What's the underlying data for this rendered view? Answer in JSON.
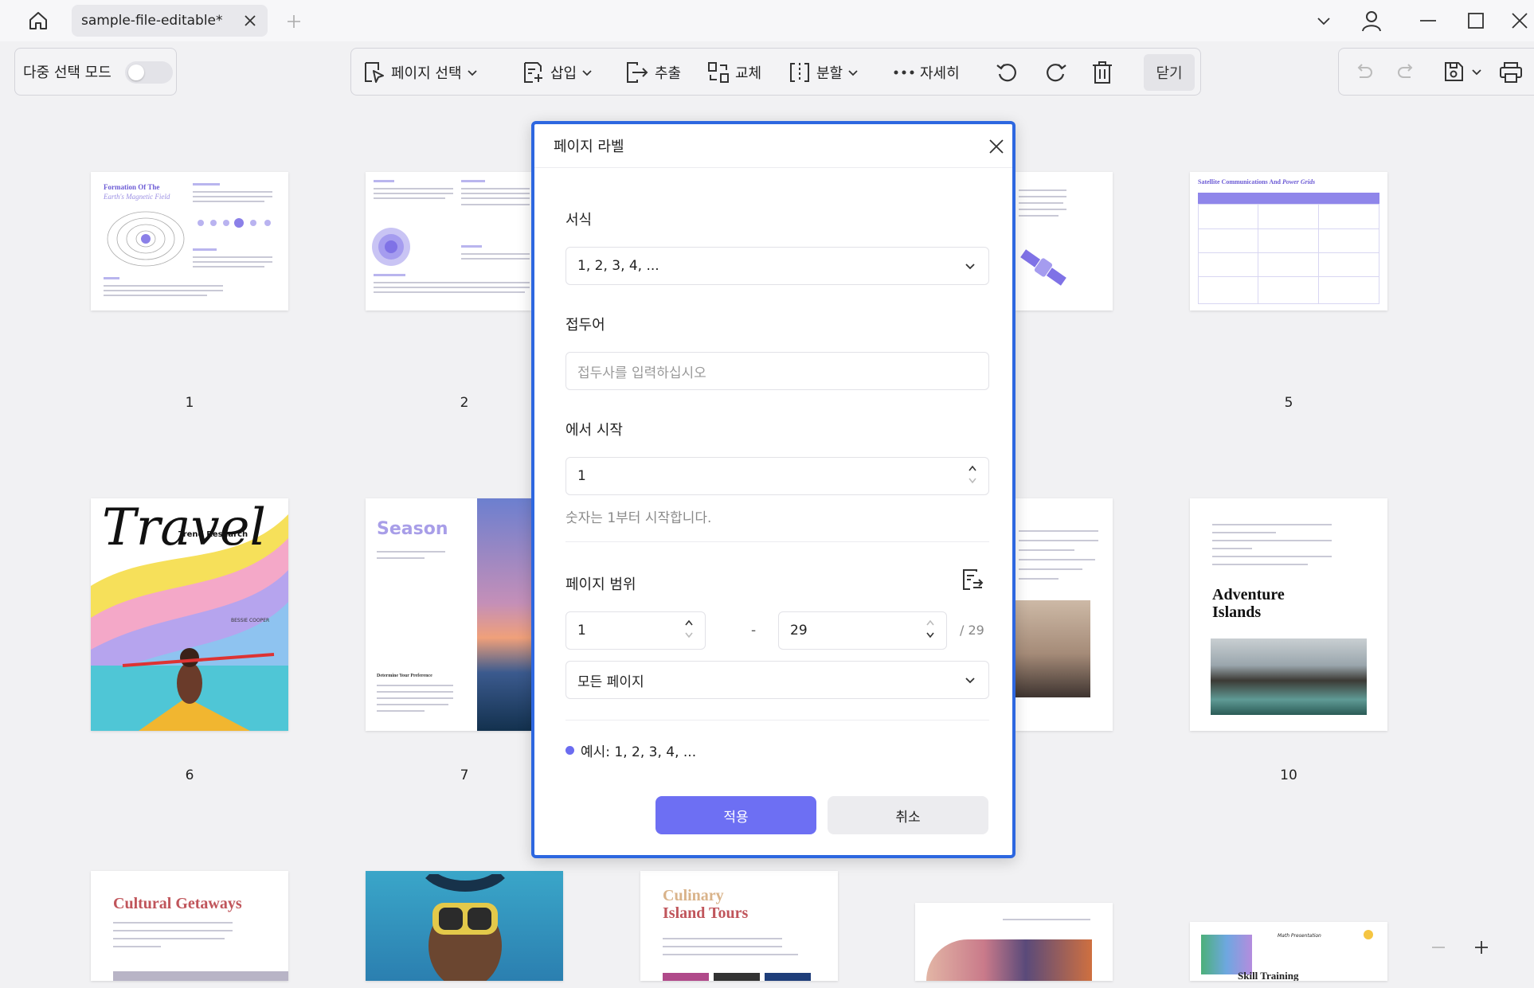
{
  "tab": {
    "title": "sample-file-editable*"
  },
  "toolbar": {
    "multi_select_label": "다중 선택 모드",
    "page_select": "페이지 선택",
    "insert": "삽입",
    "extract": "추출",
    "replace": "교체",
    "split": "분할",
    "more": "자세히",
    "close": "닫기"
  },
  "pages": {
    "p1": {
      "num": "1",
      "title": "Formation Of The",
      "subtitle": "Earth's Magnetic Field"
    },
    "p2": {
      "num": "2"
    },
    "p5": {
      "num": "5",
      "title": "Satellite Communications And",
      "title_italic": "Power Grids"
    },
    "p6": {
      "num": "6",
      "script_title": "Travel",
      "label": "Trend Research",
      "author": "BESSIE COOPER"
    },
    "p7": {
      "num": "7",
      "title": "Season",
      "heading": "Determine Your Preference"
    },
    "p10": {
      "num": "10",
      "title_line1": "Adventure",
      "title_line2": "Islands"
    },
    "p11": {
      "title": "Cultural Getaways"
    },
    "p13": {
      "title_line1": "Culinary",
      "title_line2": "Island Tours"
    },
    "p15": {
      "label": "Math Presentation",
      "title": "Skill Training"
    }
  },
  "dialog": {
    "title": "페이지 라벨",
    "format_label": "서식",
    "format_value": "1, 2, 3, 4, ...",
    "prefix_label": "접두어",
    "prefix_placeholder": "접두사를 입력하십시오",
    "start_label": "에서 시작",
    "start_value": "1",
    "hint": "숫자는 1부터 시작합니다.",
    "range_label": "페이지 범위",
    "range_from": "1",
    "range_sep": "-",
    "range_to": "29",
    "range_total": "/ 29",
    "range_scope": "모든 페이지",
    "example": "예시: 1, 2, 3, 4, ...",
    "apply": "적용",
    "cancel": "취소"
  },
  "colors": {
    "accent": "#6d6ff3",
    "dialog_border": "#2d67e0",
    "bullet": "#6b6cf0"
  }
}
